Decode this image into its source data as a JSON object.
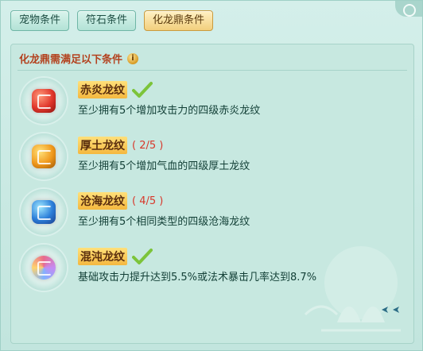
{
  "tabs": [
    {
      "label": "宠物条件",
      "active": false
    },
    {
      "label": "符石条件",
      "active": false
    },
    {
      "label": "化龙鼎条件",
      "active": true
    }
  ],
  "section": {
    "title": "化龙鼎需满足以下条件",
    "info_icon": "info-icon"
  },
  "conditions": [
    {
      "name": "赤炎龙纹",
      "progress": "",
      "completed": true,
      "gem": "red-gem-icon",
      "desc": "至少拥有5个增加攻击力的四级赤炎龙纹"
    },
    {
      "name": "厚土龙纹",
      "progress": "( 2/5 )",
      "completed": false,
      "gem": "orange-gem-icon",
      "desc": "至少拥有5个增加气血的四级厚土龙纹"
    },
    {
      "name": "沧海龙纹",
      "progress": "( 4/5 )",
      "completed": false,
      "gem": "blue-gem-icon",
      "desc": "至少拥有5个相同类型的四级沧海龙纹"
    },
    {
      "name": "混沌龙纹",
      "progress": "",
      "completed": true,
      "gem": "chaos-gem-icon",
      "desc": "基础攻击力提升达到5.5%或法术暴击几率达到8.7%"
    }
  ],
  "colors": {
    "accent": "#b3421f",
    "progress": "#d8372a",
    "check": "#7cc43a"
  }
}
